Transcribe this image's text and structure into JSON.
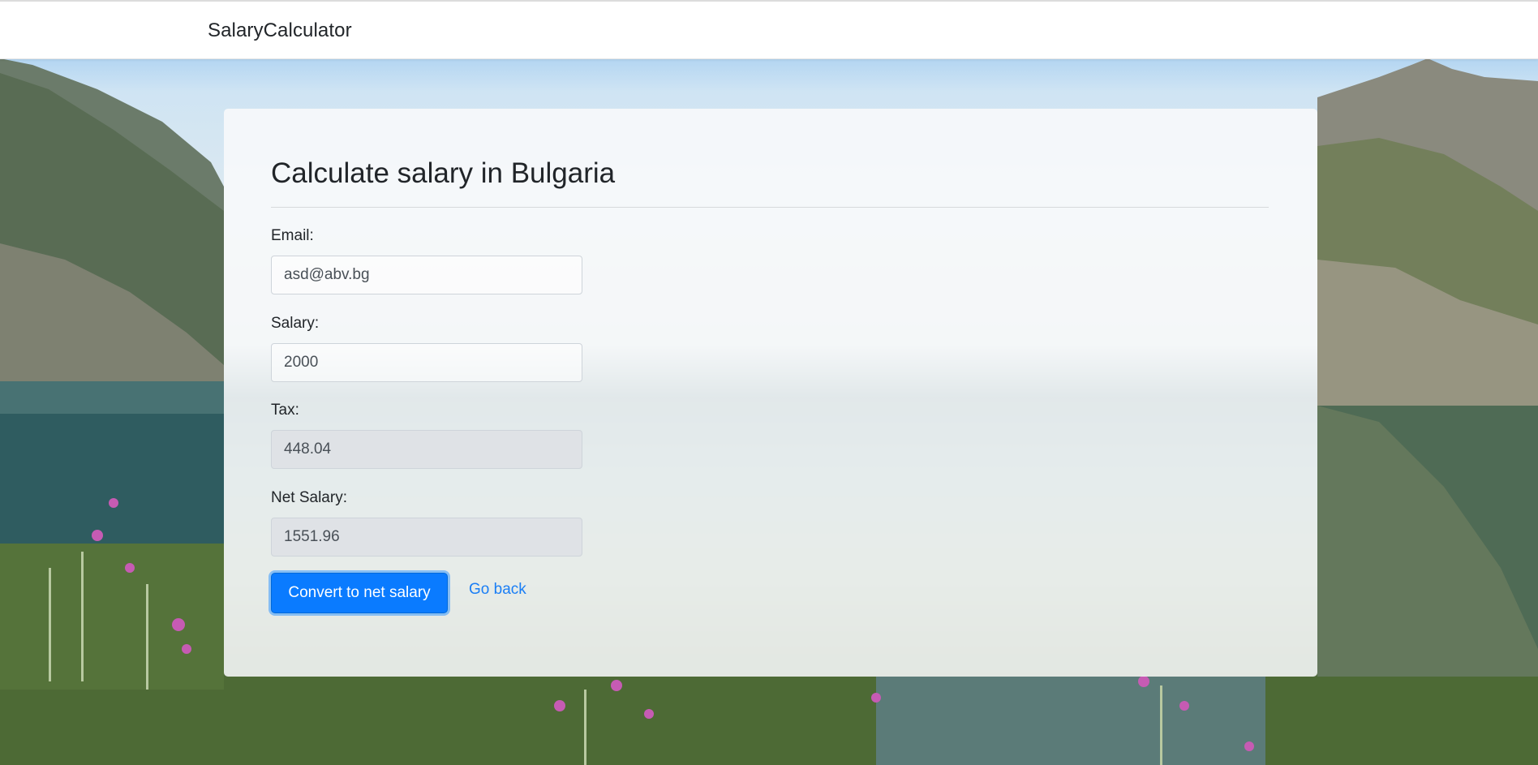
{
  "navbar": {
    "brand": "SalaryCalculator"
  },
  "form": {
    "title": "Calculate salary in Bulgaria",
    "fields": [
      {
        "label": "Email:",
        "value": "asd@abv.bg",
        "readonly": false
      },
      {
        "label": "Salary:",
        "value": "2000",
        "readonly": false
      },
      {
        "label": "Tax:",
        "value": "448.04",
        "readonly": true
      },
      {
        "label": "Net Salary:",
        "value": "1551.96",
        "readonly": true
      }
    ],
    "submit_label": "Convert to net salary",
    "back_label": "Go back"
  },
  "colors": {
    "primary": "#0a7bff",
    "link": "#1a7ef5",
    "navbar_bg": "#ffffff",
    "card_bg": "#f8f9fa"
  }
}
